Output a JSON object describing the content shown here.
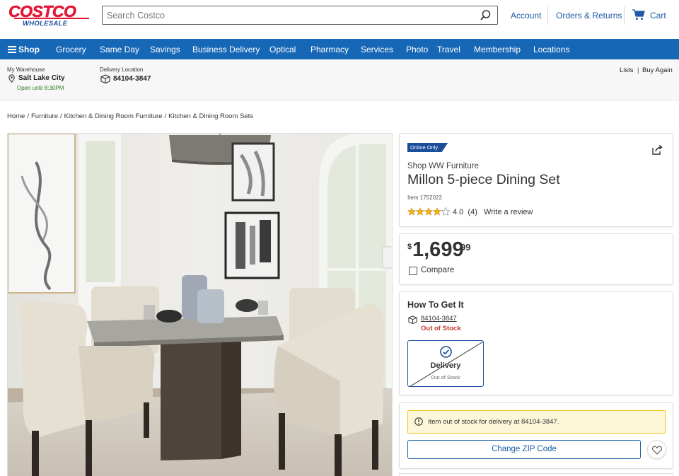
{
  "brand": {
    "logo_top": "COSTCO",
    "logo_bottom": "WHOLESALE"
  },
  "search": {
    "placeholder": "Search Costco",
    "icon": "search-icon"
  },
  "header_links": {
    "account": "Account",
    "orders": "Orders & Returns",
    "cart": "Cart"
  },
  "nav": {
    "shop": "Shop",
    "items": [
      "Grocery",
      "Same Day",
      "Savings",
      "Business Delivery",
      "Optical",
      "Pharmacy",
      "Services",
      "Photo",
      "Travel",
      "Membership",
      "Locations"
    ]
  },
  "warehouse": {
    "label": "My Warehouse",
    "name": "Salt Lake City",
    "hours": "Open until 8:30PM"
  },
  "delivery_location": {
    "label": "Delivery Location",
    "zip": "84104-3847"
  },
  "sub_links": {
    "lists": "Lists",
    "buy_again": "Buy Again"
  },
  "breadcrumbs": [
    "Home",
    "Furniture",
    "Kitchen & Dining Room Furniture",
    "Kitchen & Dining Room Sets"
  ],
  "product": {
    "badge": "Online Only",
    "brand_link": "Shop WW Furniture",
    "title": "Millon 5-piece Dining Set",
    "item_number": "Item 1752022",
    "rating_value": "4.0",
    "rating_count": "(4)",
    "rating_stars": 4.0,
    "write_review": "Write a review"
  },
  "price": {
    "currency": "$",
    "whole": "1,699",
    "cents": "99"
  },
  "compare": {
    "label": "Compare"
  },
  "fulfillment": {
    "heading": "How To Get It",
    "zip": "84104-3847",
    "status": "Out of Stock",
    "delivery_title": "Delivery",
    "delivery_status": "Out of Stock"
  },
  "alert": {
    "text": "Item out of stock for delivery at 84104-3847."
  },
  "actions": {
    "change_zip": "Change ZIP Code"
  },
  "colors": {
    "nav_blue": "#1767b7",
    "badge_blue": "#1a4e9b",
    "logo_red": "#e31837",
    "alert_yellow": "#f0c514",
    "oos_red": "#c0392b"
  }
}
